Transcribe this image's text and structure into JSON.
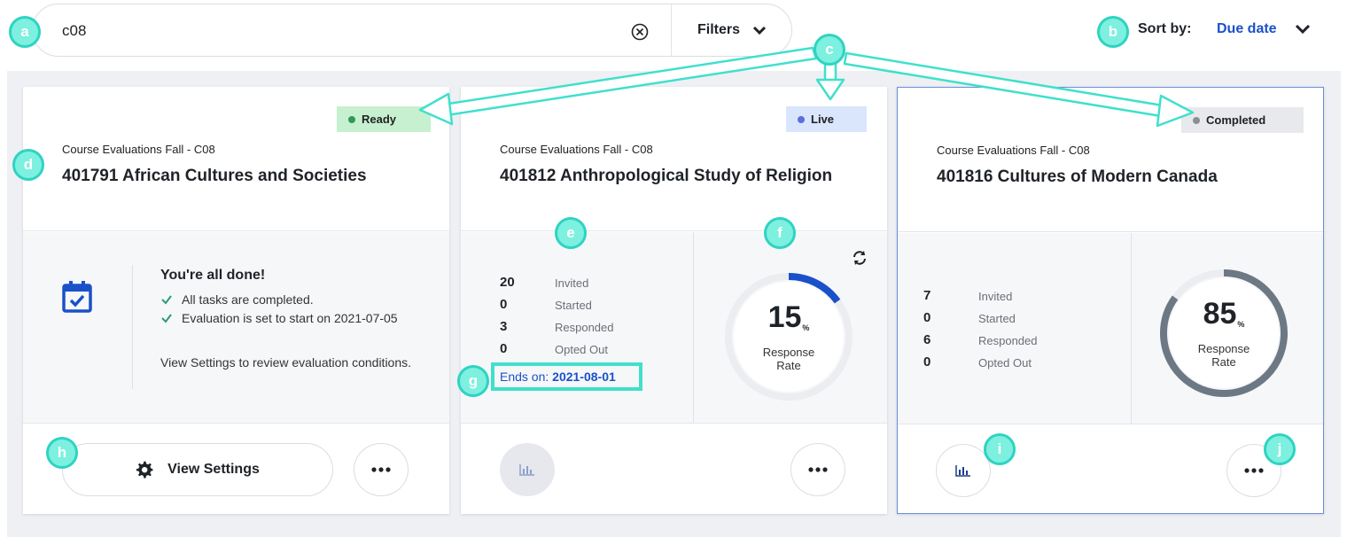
{
  "search": {
    "value": "c08"
  },
  "filters": {
    "label": "Filters"
  },
  "sort": {
    "label": "Sort by:",
    "value": "Due date"
  },
  "cards": [
    {
      "status": "Ready",
      "status_color": "#2f9a57",
      "status_bg": "#c6f0cf",
      "subtitle": "Course Evaluations Fall - C08",
      "title": "401791 African Cultures and Societies",
      "done_title": "You're all done!",
      "checklist": [
        "All tasks are completed.",
        "Evaluation is set to start on 2021-07-05"
      ],
      "note": "View Settings to review evaluation conditions.",
      "button_label": "View Settings"
    },
    {
      "status": "Live",
      "status_color": "#5b6de0",
      "status_bg": "#d9e6fb",
      "subtitle": "Course Evaluations Fall - C08",
      "title": "401812 Anthropological Study of Religion",
      "stats": [
        {
          "value": "20",
          "label": "Invited"
        },
        {
          "value": "0",
          "label": "Started"
        },
        {
          "value": "3",
          "label": "Responded"
        },
        {
          "value": "0",
          "label": "Opted Out"
        }
      ],
      "ends_label": "Ends on:",
      "ends_date": "2021-08-01",
      "rate": "15",
      "rate_fraction": 0.15,
      "rate_unit": "%",
      "rate_label_1": "Response",
      "rate_label_2": "Rate",
      "ring_color": "#1a51c9"
    },
    {
      "status": "Completed",
      "status_color": "#8a8f96",
      "status_bg": "#e8e9ec",
      "subtitle": "Course Evaluations Fall - C08",
      "title": "401816 Cultures of Modern Canada",
      "stats": [
        {
          "value": "7",
          "label": "Invited"
        },
        {
          "value": "0",
          "label": "Started"
        },
        {
          "value": "6",
          "label": "Responded"
        },
        {
          "value": "0",
          "label": "Opted Out"
        }
      ],
      "rate": "85",
      "rate_fraction": 0.85,
      "rate_unit": "%",
      "rate_label_1": "Response",
      "rate_label_2": "Rate",
      "ring_color": "#6d7885"
    }
  ],
  "annotations": [
    "a",
    "b",
    "c",
    "d",
    "e",
    "f",
    "g",
    "h",
    "i",
    "j"
  ],
  "colors": {
    "accent": "#1a51c9",
    "annotation": "#7df0df",
    "annotation_border": "#2fd3c2",
    "board": "#eef0f4"
  }
}
